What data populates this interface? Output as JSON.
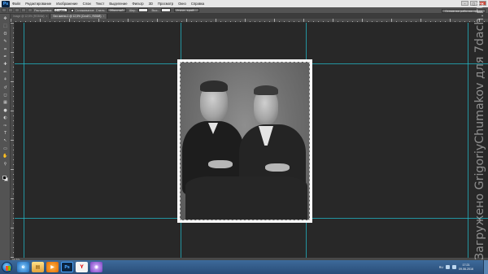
{
  "app": {
    "logo": "Ps",
    "menu": [
      "Файл",
      "Редактирование",
      "Изображение",
      "Слои",
      "Текст",
      "Выделение",
      "Фильтр",
      "3D",
      "Просмотр",
      "Окно",
      "Справка"
    ],
    "window_controls": [
      "–",
      "□",
      "✕"
    ]
  },
  "options_bar": {
    "feather_label": "Растушевка:",
    "feather_value": "0 пикс.",
    "antialias_label": "Сглаживание",
    "style_label": "Стиль:",
    "style_value": "Обычный",
    "width_label": "Шир.:",
    "height_label": "Выс.:",
    "refine_button": "Уточн. край...",
    "workspace_button": "Основная рабочая среда"
  },
  "tabs": [
    {
      "label": "Image @ 12,5% (RGB/8#)",
      "active": false
    },
    {
      "label": "Без имени-1 @ 12,5% (Слой 1, RGB/8)",
      "active": true
    }
  ],
  "tools": [
    "move-icon",
    "marquee-icon",
    "lasso-icon",
    "quick-select-icon",
    "crop-icon",
    "eyedropper-icon",
    "healing-icon",
    "brush-icon",
    "clone-stamp-icon",
    "history-brush-icon",
    "eraser-icon",
    "gradient-icon",
    "blur-icon",
    "dodge-icon",
    "pen-icon",
    "type-icon",
    "path-select-icon",
    "shape-icon",
    "hand-icon",
    "zoom-icon"
  ],
  "status": {
    "zoom": "12,5%"
  },
  "taskbar": {
    "apps": [
      {
        "icon": "internet-explorer-icon",
        "glyph": "e"
      },
      {
        "icon": "folder-icon",
        "glyph": "▤"
      },
      {
        "icon": "media-player-icon",
        "glyph": "▶"
      },
      {
        "icon": "photoshop-icon",
        "glyph": "Ps"
      },
      {
        "icon": "yandex-browser-icon",
        "glyph": "Y"
      },
      {
        "icon": "app-icon",
        "glyph": "◉"
      }
    ],
    "language": "RU",
    "time": "17:21",
    "date": "09.06.2016"
  },
  "watermark": "Загружено GrigoriyChumakov для 7dach.ru",
  "colors": {
    "guide": "#22b8c8",
    "canvas_bg": "#282828",
    "panel_bg": "#535353"
  }
}
